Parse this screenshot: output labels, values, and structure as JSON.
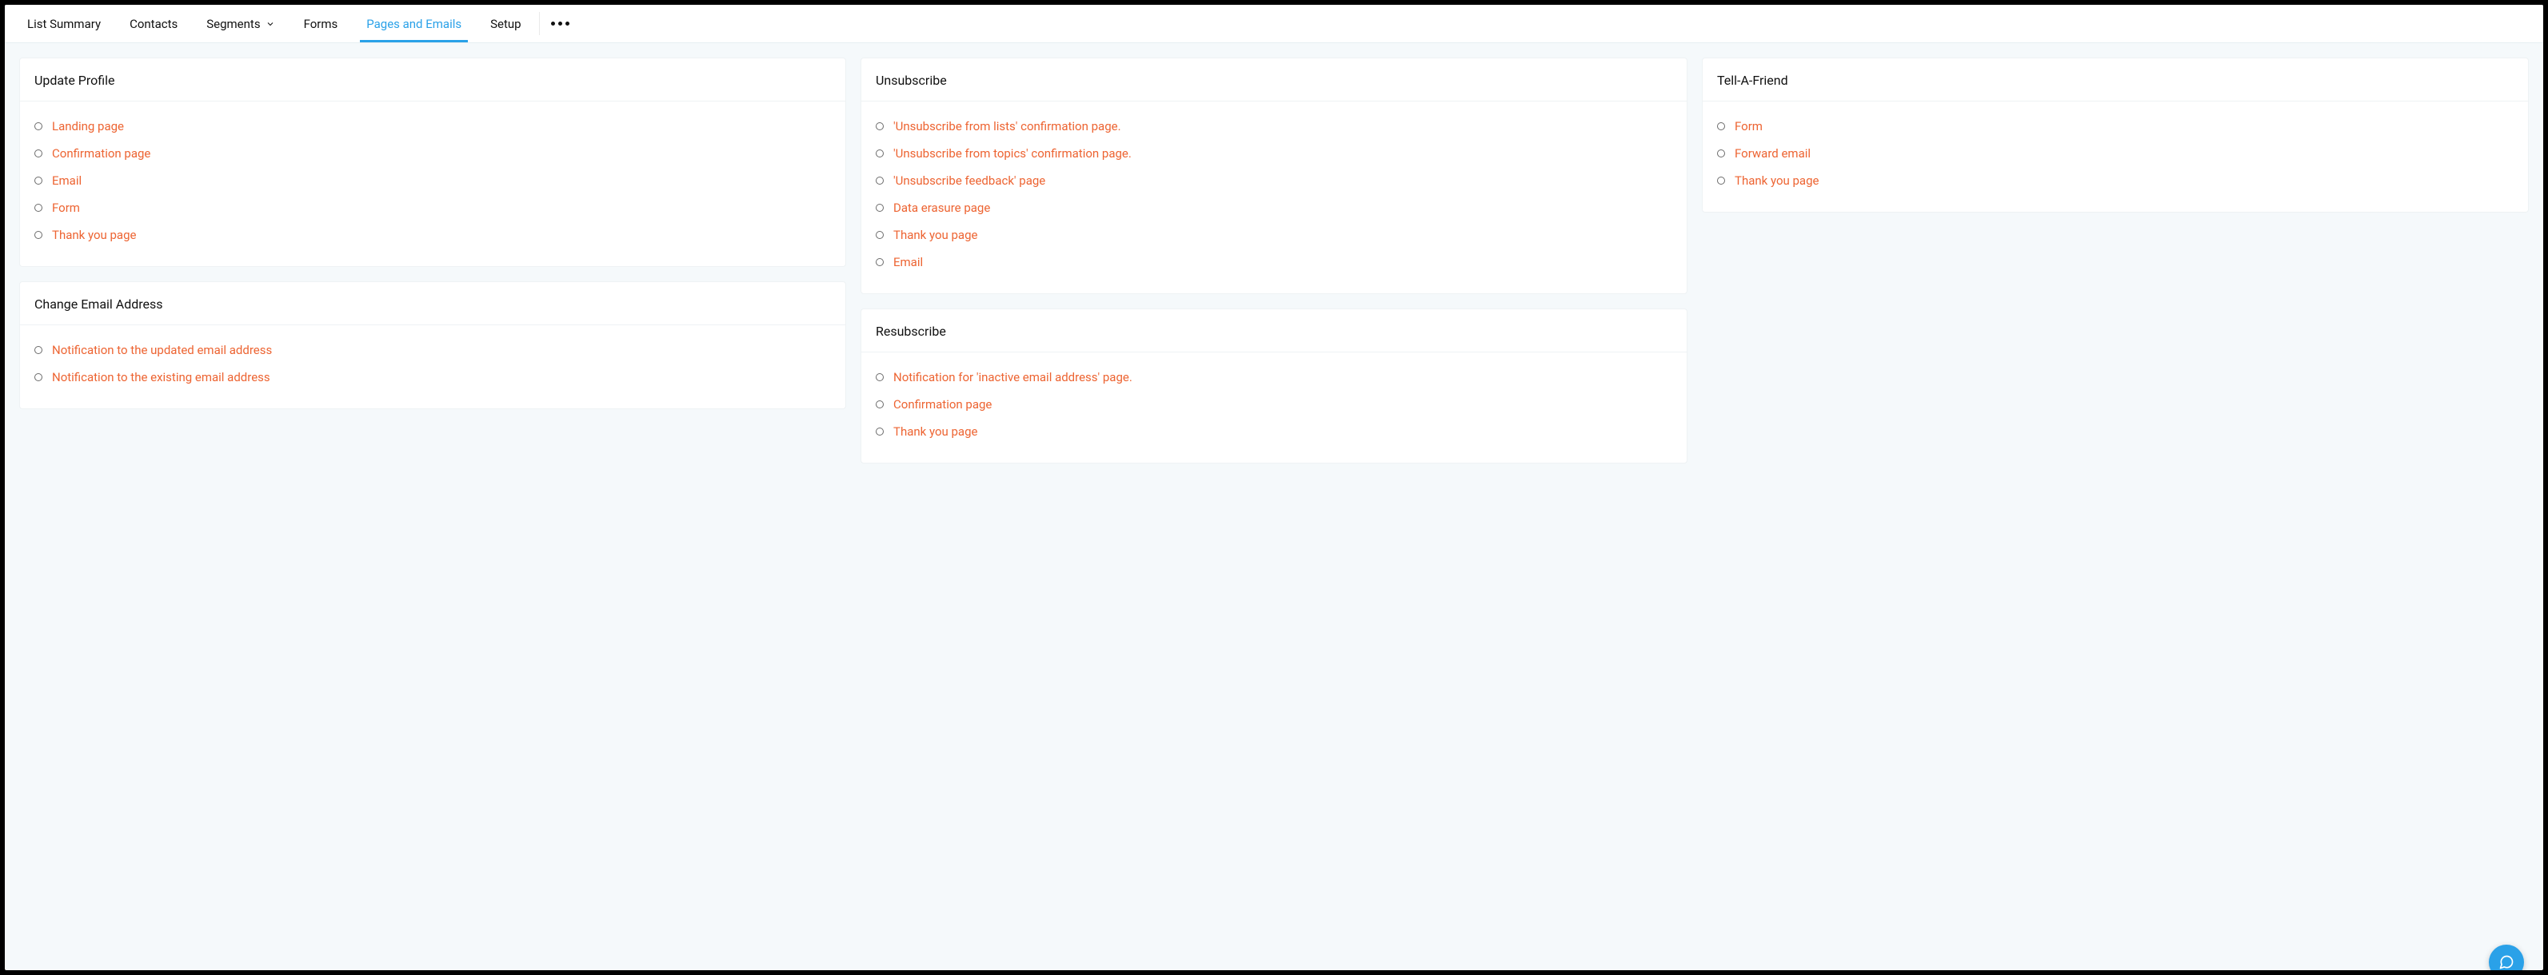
{
  "tabs": {
    "list_summary": "List Summary",
    "contacts": "Contacts",
    "segments": "Segments",
    "forms": "Forms",
    "pages_emails": "Pages and Emails",
    "setup": "Setup"
  },
  "colors": {
    "accent_link": "#ed6432",
    "tab_active": "#2aa1e8"
  },
  "cards": {
    "update_profile": {
      "title": "Update Profile",
      "items": {
        "0": "Landing page",
        "1": "Confirmation page",
        "2": "Email",
        "3": "Form",
        "4": "Thank you page"
      }
    },
    "unsubscribe": {
      "title": "Unsubscribe",
      "items": {
        "0": "'Unsubscribe from lists' confirmation page.",
        "1": "'Unsubscribe from topics' confirmation page.",
        "2": "'Unsubscribe feedback' page",
        "3": "Data erasure page",
        "4": "Thank you page",
        "5": "Email"
      }
    },
    "tell_a_friend": {
      "title": "Tell-A-Friend",
      "items": {
        "0": "Form",
        "1": "Forward email",
        "2": "Thank you page"
      }
    },
    "change_email": {
      "title": "Change Email Address",
      "items": {
        "0": "Notification to the updated email address",
        "1": "Notification to the existing email address"
      }
    },
    "resubscribe": {
      "title": "Resubscribe",
      "items": {
        "0": "Notification for 'inactive email address' page.",
        "1": "Confirmation page",
        "2": "Thank you page"
      }
    }
  }
}
